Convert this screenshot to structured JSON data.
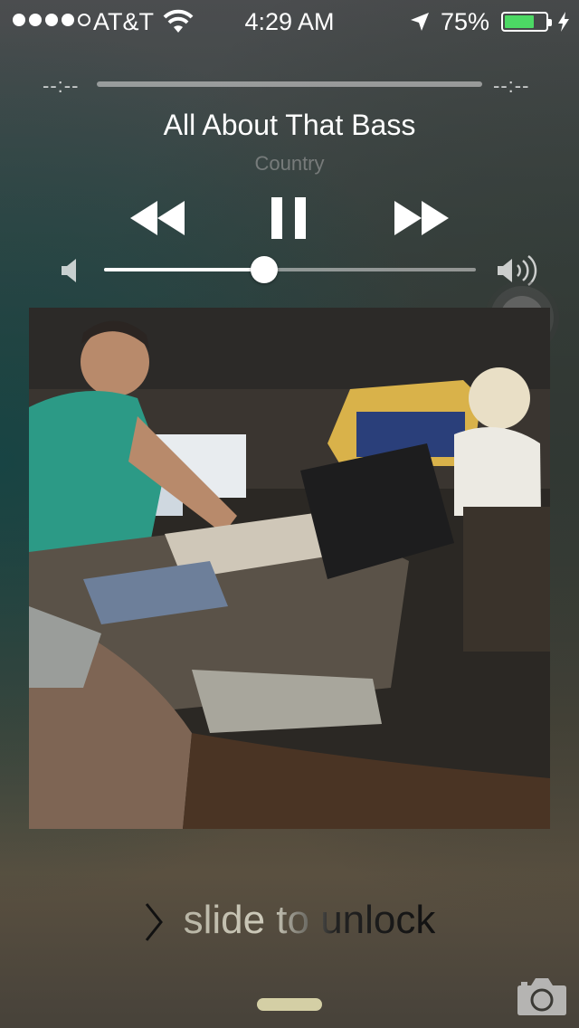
{
  "status_bar": {
    "carrier": "AT&T",
    "time": "4:29 AM",
    "battery_percent": "75%",
    "battery_level": 0.75,
    "signal_bars_filled": 4,
    "signal_bars_total": 5,
    "icons": [
      "signal-dots",
      "wifi-icon",
      "location-arrow-icon",
      "battery-icon",
      "charging-bolt-icon"
    ]
  },
  "player": {
    "elapsed": "--:--",
    "remaining": "--:--",
    "song_title": "All About That Bass",
    "artist": "Country",
    "volume_level": 0.43,
    "controls": [
      "rewind-icon",
      "pause-icon",
      "fast-forward-icon"
    ],
    "volume_icons": [
      "speaker-low-icon",
      "speaker-high-icon"
    ]
  },
  "lock": {
    "slide_text": "slide to unlock"
  },
  "colors": {
    "battery_fill": "#4cd964",
    "grabber": "#d4cfa5"
  }
}
